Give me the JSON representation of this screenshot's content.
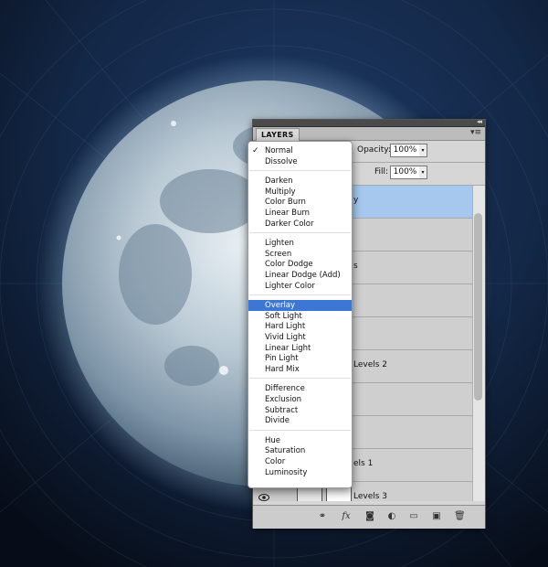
{
  "panel": {
    "tab_label": "LAYERS",
    "opacity_label": "Opacity:",
    "opacity_value": "100%",
    "fill_label": "Fill:",
    "fill_value": "100%"
  },
  "layers": [
    {
      "name": "y",
      "selected": true
    },
    {
      "name": "",
      "selected": false
    },
    {
      "name": "s",
      "selected": false
    },
    {
      "name": "",
      "selected": false
    },
    {
      "name": "",
      "selected": false
    },
    {
      "name": "Levels 2",
      "selected": false
    },
    {
      "name": "",
      "selected": false
    },
    {
      "name": "",
      "selected": false
    },
    {
      "name": "els 1",
      "selected": false
    },
    {
      "name": "Levels 3",
      "selected": false
    }
  ],
  "blend_menu": {
    "checked_item": "Normal",
    "selected_item": "Overlay",
    "groups": [
      [
        "Normal",
        "Dissolve"
      ],
      [
        "Darken",
        "Multiply",
        "Color Burn",
        "Linear Burn",
        "Darker Color"
      ],
      [
        "Lighten",
        "Screen",
        "Color Dodge",
        "Linear Dodge (Add)",
        "Lighter Color"
      ],
      [
        "Overlay",
        "Soft Light",
        "Hard Light",
        "Vivid Light",
        "Linear Light",
        "Pin Light",
        "Hard Mix"
      ],
      [
        "Difference",
        "Exclusion",
        "Subtract",
        "Divide"
      ],
      [
        "Hue",
        "Saturation",
        "Color",
        "Luminosity"
      ]
    ]
  },
  "bottom_icons": [
    "link-icon",
    "fx-icon",
    "mask-icon",
    "adjustment-icon",
    "folder-icon",
    "new-layer-icon",
    "trash-icon"
  ],
  "colors": {
    "selection_blue": "#3d77d6",
    "layer_selected": "#a7c8ee",
    "panel_gray": "#d6d6d6"
  }
}
